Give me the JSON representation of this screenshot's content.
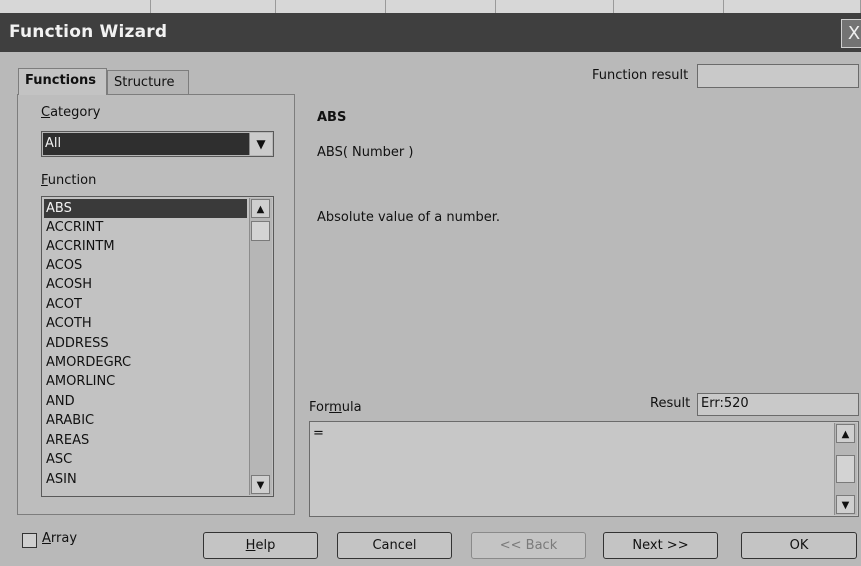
{
  "window": {
    "title": "Function Wizard",
    "close_glyph": "X"
  },
  "tabs": [
    {
      "label": "Functions",
      "active": true
    },
    {
      "label": "Structure",
      "active": false
    }
  ],
  "category": {
    "label": "Category",
    "selected": "All"
  },
  "function_list": {
    "label": "Function",
    "items": [
      "ABS",
      "ACCRINT",
      "ACCRINTM",
      "ACOS",
      "ACOSH",
      "ACOT",
      "ACOTH",
      "ADDRESS",
      "AMORDEGRC",
      "AMORLINC",
      "AND",
      "ARABIC",
      "AREAS",
      "ASC",
      "ASIN"
    ],
    "selected_index": 0
  },
  "function_result": {
    "label": "Function result",
    "value": ""
  },
  "detail": {
    "name": "ABS",
    "signature": "ABS( Number )",
    "description": "Absolute value of a number."
  },
  "formula": {
    "label": "Formula",
    "value": "="
  },
  "result": {
    "label": "Result",
    "value": "Err:520"
  },
  "array_checkbox": {
    "label": "Array",
    "checked": false
  },
  "buttons": {
    "help": "Help",
    "cancel": "Cancel",
    "back": "<< Back",
    "next": "Next >>",
    "ok": "OK"
  }
}
